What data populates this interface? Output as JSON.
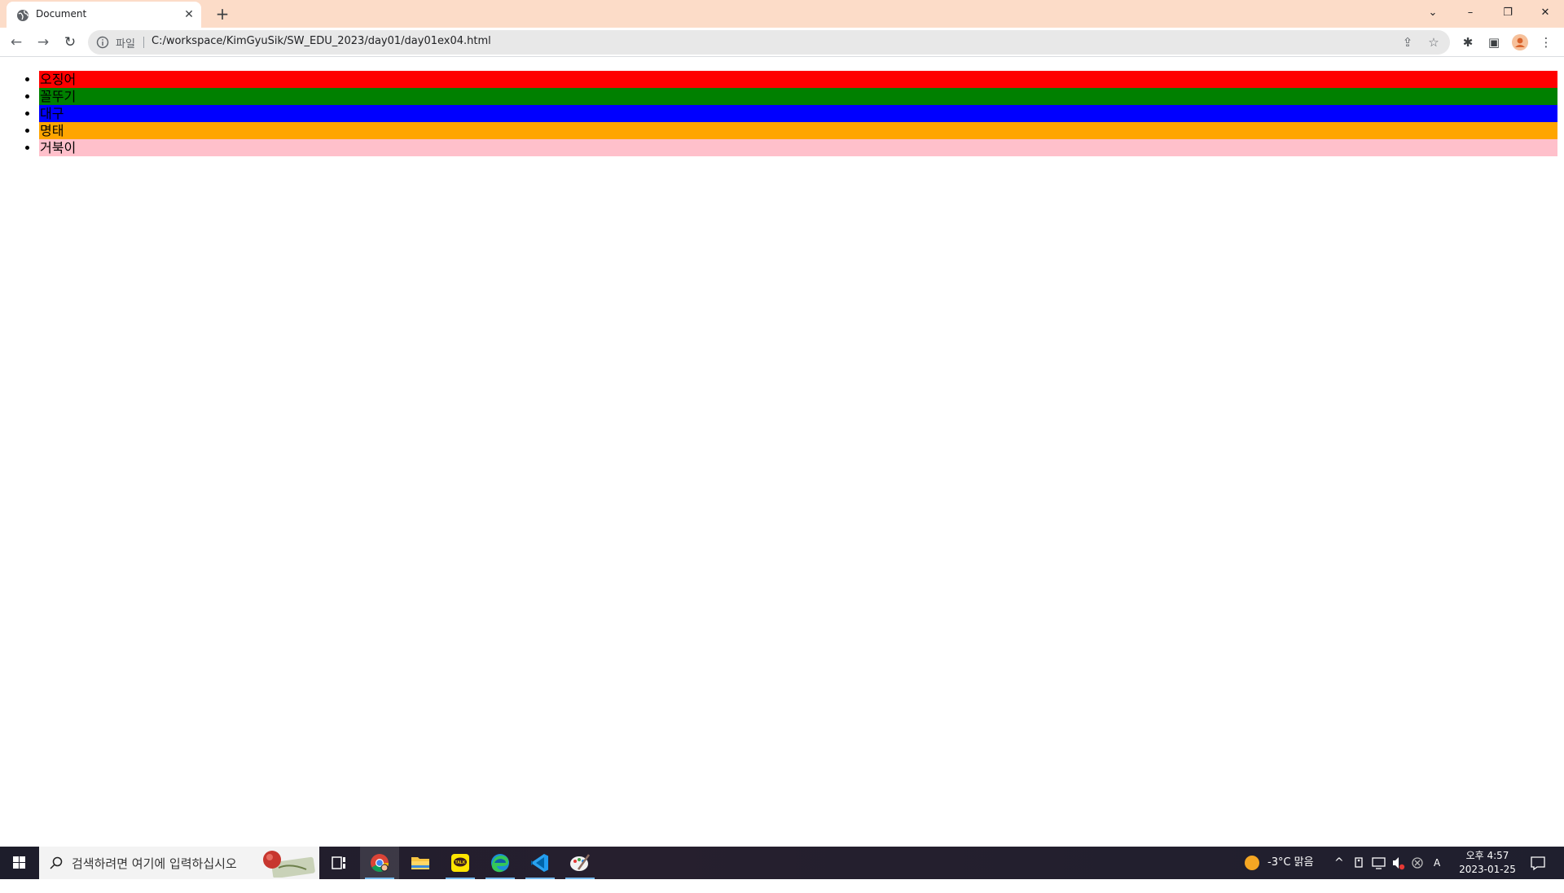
{
  "browser": {
    "tab_title": "Document",
    "address_chip": "파일",
    "url": "C:/workspace/KimGyuSik/SW_EDU_2023/day01/day01ex04.html",
    "icons": {
      "favicon": "globe-icon",
      "tab_close": "close-icon",
      "new_tab": "plus-icon",
      "tab_search": "chevron-down-icon",
      "minimize": "minimize-icon",
      "restore": "restore-icon",
      "close": "close-icon",
      "back": "back-arrow-icon",
      "forward": "forward-arrow-icon",
      "reload": "reload-icon",
      "site_info": "info-icon",
      "share": "share-icon",
      "bookmark": "star-icon",
      "extensions": "puzzle-icon",
      "side_panel": "side-panel-icon",
      "profile": "avatar-icon",
      "menu": "kebab-menu-icon"
    },
    "colors": {
      "titlebar": "#fcdcc8",
      "omnibox": "#e8e8e8"
    }
  },
  "page": {
    "items": [
      {
        "label": "오징어",
        "color": "#ff0000"
      },
      {
        "label": "꼴뚜기",
        "color": "#008000"
      },
      {
        "label": "대구",
        "color": "#0000ff"
      },
      {
        "label": "명태",
        "color": "#ffa500"
      },
      {
        "label": "거북이",
        "color": "#ffc0cb"
      }
    ]
  },
  "taskbar": {
    "search_placeholder": "검색하려면 여기에 입력하십시오",
    "apps": [
      "task-view-icon",
      "chrome-icon",
      "file-explorer-icon",
      "kakaotalk-icon",
      "edge-icon",
      "vscode-icon",
      "paint-icon"
    ],
    "kakaotalk_label": "TALK",
    "weather": "-3°C  맑음",
    "ime": "A",
    "time": "오후 4:57",
    "date": "2023-01-25"
  }
}
